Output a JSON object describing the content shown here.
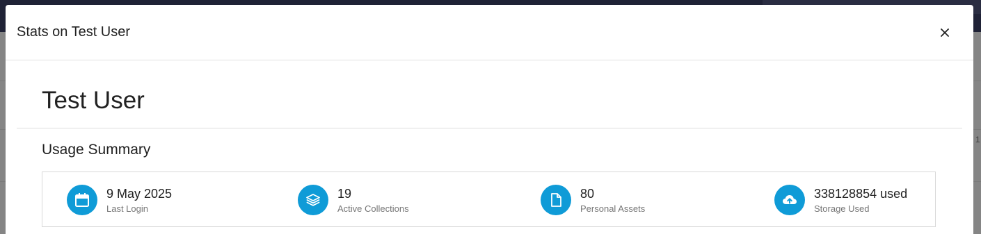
{
  "modal": {
    "title": "Stats on Test User",
    "close_icon": "close-icon"
  },
  "user": {
    "name": "Test User"
  },
  "usage_summary": {
    "title": "Usage Summary",
    "stats": [
      {
        "icon": "calendar-icon",
        "value": "9 May 2025",
        "label": "Last Login"
      },
      {
        "icon": "layers-icon",
        "value": "19",
        "label": "Active Collections"
      },
      {
        "icon": "file-icon",
        "value": "80",
        "label": "Personal Assets"
      },
      {
        "icon": "cloud-upload-icon",
        "value": "338128854 used",
        "label": "Storage Used"
      }
    ]
  },
  "colors": {
    "accent": "#0f9bd7",
    "header_bar": "#1f2236",
    "overlay": "#858585"
  },
  "backdrop": {
    "edge_text": "1"
  }
}
